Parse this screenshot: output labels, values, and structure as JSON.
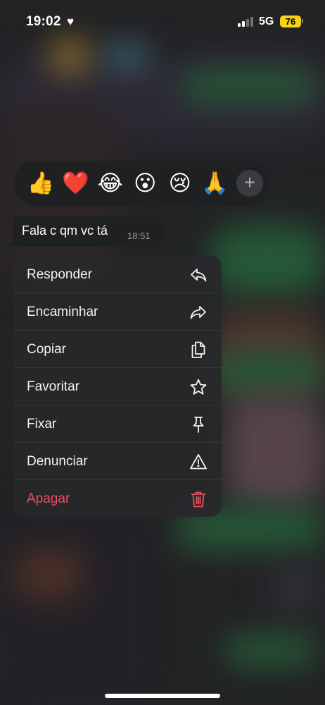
{
  "status_bar": {
    "time": "19:02",
    "network": "5G",
    "battery": "76"
  },
  "reactions": [
    {
      "emoji": "👍",
      "name": "thumbs-up"
    },
    {
      "emoji": "❤️",
      "name": "heart"
    },
    {
      "emoji": "😂",
      "name": "tears-of-joy"
    },
    {
      "emoji": "😮",
      "name": "surprised"
    },
    {
      "emoji": "😢",
      "name": "crying"
    },
    {
      "emoji": "🙏",
      "name": "folded-hands"
    }
  ],
  "reaction_more": "+",
  "message": {
    "text": "Fala c qm vc tá",
    "time": "18:51"
  },
  "menu": {
    "items": [
      {
        "label": "Responder",
        "icon": "reply-icon"
      },
      {
        "label": "Encaminhar",
        "icon": "forward-icon"
      },
      {
        "label": "Copiar",
        "icon": "copy-icon"
      },
      {
        "label": "Favoritar",
        "icon": "star-icon"
      },
      {
        "label": "Fixar",
        "icon": "pin-icon"
      },
      {
        "label": "Denunciar",
        "icon": "warning-icon"
      },
      {
        "label": "Apagar",
        "icon": "trash-icon",
        "danger": true
      }
    ]
  },
  "colors": {
    "danger": "#ea4f5f",
    "battery": "#f7d316",
    "bubble": "#1f2022"
  }
}
